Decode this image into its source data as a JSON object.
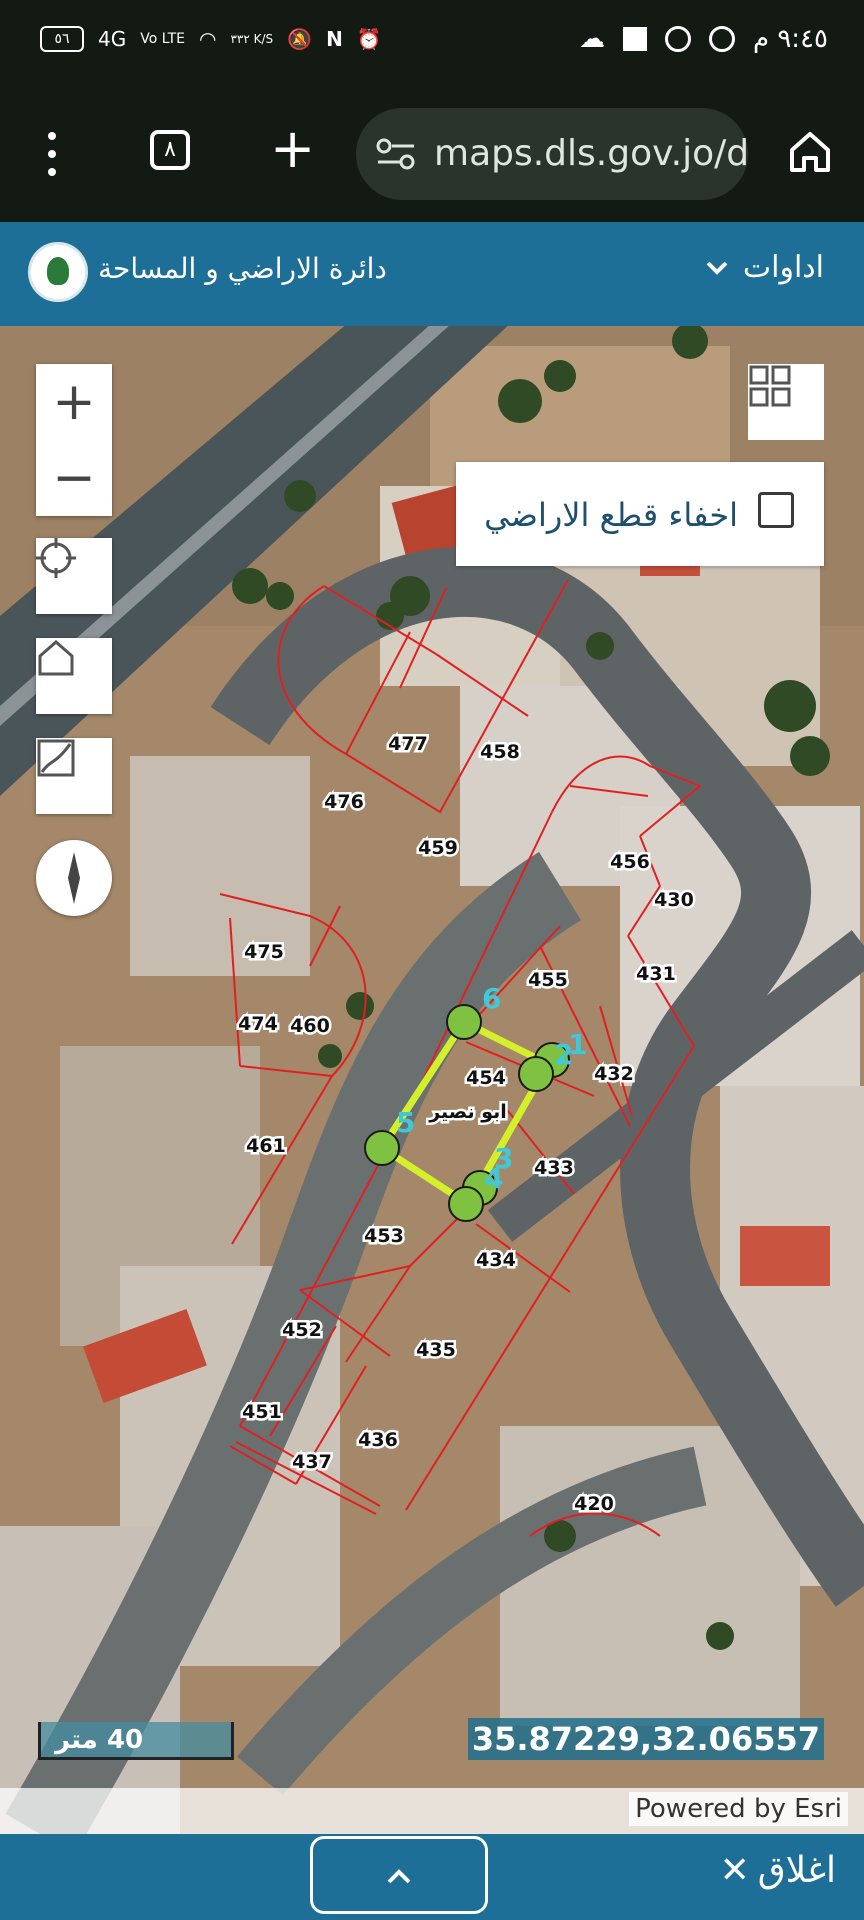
{
  "status_bar": {
    "battery": "٥٦",
    "network": "4G",
    "volte": "Vo LTE",
    "speed": "٣٣٢ K/S",
    "time": "٩:٤٥ م"
  },
  "browser": {
    "tab_count": "٨",
    "url": "maps.dls.gov.jo/d"
  },
  "header": {
    "site_name": "دائرة الاراضي و المساحة",
    "tools_label": "اداوات"
  },
  "map": {
    "hide_parcels_label": "اخفاء قطع الاراضي",
    "hide_parcels_checked": false,
    "scale_label": "40 متر",
    "coordinates": "35.87229,32.06557",
    "attribution": "Powered by Esri",
    "selected_parcel_name": "ابو نصير",
    "vertex_labels": [
      "1",
      "2",
      "3",
      "4",
      "5",
      "6"
    ],
    "parcels": [
      "477",
      "458",
      "476",
      "459",
      "456",
      "430",
      "475",
      "455",
      "431",
      "474",
      "460",
      "454",
      "432",
      "461",
      "433",
      "453",
      "434",
      "452",
      "435",
      "436",
      "451",
      "437",
      "420"
    ],
    "colors": {
      "parcel_lines": "#e02020",
      "selection": "#d4f02a",
      "vertex": "#7fc241",
      "vertex_label": "#3ec8d8"
    }
  },
  "bottom_bar": {
    "close_label": "اغلاق",
    "toggle_icon": "chevron-up-icon"
  }
}
